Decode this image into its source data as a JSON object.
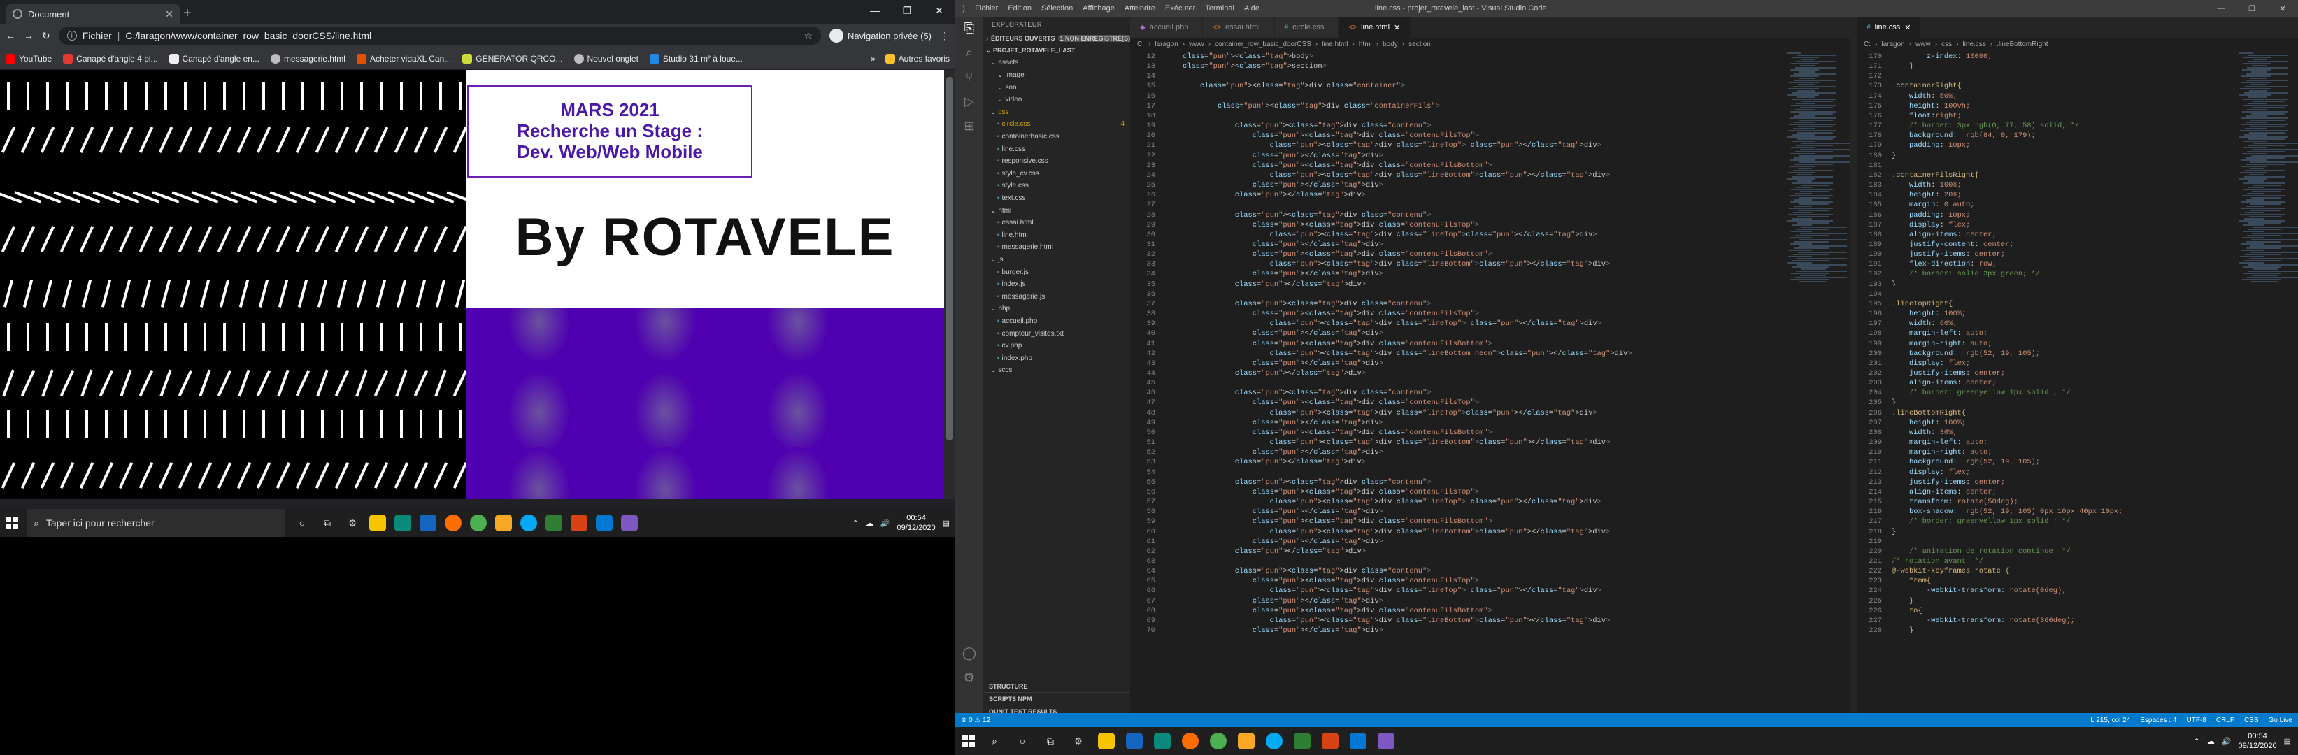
{
  "chrome": {
    "tab_title": "Document",
    "url_prefix": "Fichier",
    "url": "C:/laragon/www/container_row_basic_doorCSS/line.html",
    "private_label": "Navigation privée (5)",
    "bookmarks": [
      "YouTube",
      "Canapé d'angle 4 pl...",
      "Canapé d'angle en...",
      "messagerie.html",
      "Acheter vidaXL Can...",
      "GENERATOR QRCO...",
      "Nouvel onglet",
      "Studio 31 m² à loue..."
    ],
    "bookmarks_more": "»",
    "bookmarks_other": "Autres favoris"
  },
  "page": {
    "line1": "MARS 2021",
    "line2": "Recherche un Stage :",
    "line3": "Dev. Web/Web Mobile",
    "byline": "By ROTAVELE"
  },
  "taskbar": {
    "search_placeholder": "Taper ici pour rechercher",
    "time": "00:54",
    "date": "09/12/2020"
  },
  "vscode": {
    "title": "line.css - projet_rotavele_last - Visual Studio Code",
    "menu": [
      "Fichier",
      "Edition",
      "Sélection",
      "Affichage",
      "Atteindre",
      "Exécuter",
      "Terminal",
      "Aide"
    ],
    "explorer_label": "EXPLORATEUR",
    "open_editors": "ÉDITEURS OUVERTS",
    "unsaved_badge": "1 NON ENREGISTRÉ(S)",
    "project": "PROJET_ROTAVELE_LAST",
    "tree": [
      {
        "name": "assets",
        "depth": 1,
        "folder": true
      },
      {
        "name": "image",
        "depth": 2,
        "folder": true
      },
      {
        "name": "son",
        "depth": 2,
        "folder": true
      },
      {
        "name": "video",
        "depth": 2,
        "folder": true
      },
      {
        "name": "css",
        "depth": 1,
        "folder": true,
        "color": "#cca700"
      },
      {
        "name": "circle.css",
        "depth": 2,
        "badge": "4",
        "color": "#cca700"
      },
      {
        "name": "containerbasic.css",
        "depth": 2
      },
      {
        "name": "line.css",
        "depth": 2
      },
      {
        "name": "responsive.css",
        "depth": 2
      },
      {
        "name": "style_cv.css",
        "depth": 2
      },
      {
        "name": "style.css",
        "depth": 2
      },
      {
        "name": "text.css",
        "depth": 2
      },
      {
        "name": "html",
        "depth": 1,
        "folder": true
      },
      {
        "name": "essai.html",
        "depth": 2
      },
      {
        "name": "line.html",
        "depth": 2
      },
      {
        "name": "messagerie.html",
        "depth": 2
      },
      {
        "name": "js",
        "depth": 1,
        "folder": true
      },
      {
        "name": "burger.js",
        "depth": 2
      },
      {
        "name": "index.js",
        "depth": 2
      },
      {
        "name": "messagerie.js",
        "depth": 2
      },
      {
        "name": "php",
        "depth": 1,
        "folder": true
      },
      {
        "name": "accueil.php",
        "depth": 2
      },
      {
        "name": "compteur_visites.txt",
        "depth": 2
      },
      {
        "name": "cv.php",
        "depth": 2
      },
      {
        "name": "index.php",
        "depth": 2
      },
      {
        "name": "sccs",
        "depth": 1,
        "folder": true
      }
    ],
    "footer_sections": [
      "STRUCTURE",
      "SCRIPTS NPM",
      "QUNIT TEST RESULTS"
    ],
    "tabs_left": [
      "accueil.php",
      "essai.html",
      "circle.css",
      "line.html"
    ],
    "tabs_right": [
      "line.css"
    ],
    "breadcrumb_left": [
      "C:",
      "laragon",
      "www",
      "container_row_basic_doorCSS",
      "line.html",
      "html",
      "body",
      "section"
    ],
    "breadcrumb_right": [
      "C:",
      "laragon",
      "www",
      "css",
      "line.css",
      ".lineBottomRight"
    ],
    "status_left": "⊗ 0 ⚠ 12",
    "status_right": [
      "L 215, col 24",
      "Espaces : 4",
      "UTF-8",
      "CRLF",
      "CSS",
      "Go Live"
    ]
  },
  "html_code": [
    [
      12,
      "    <body>"
    ],
    [
      13,
      "    <section>"
    ],
    [
      14,
      ""
    ],
    [
      15,
      "        <div class=\"container\">"
    ],
    [
      16,
      ""
    ],
    [
      17,
      "            <div class=\"containerFils\">"
    ],
    [
      18,
      ""
    ],
    [
      19,
      "                <div class=\"contenu\">"
    ],
    [
      20,
      "                    <div class=\"contenuFilsTop\">"
    ],
    [
      21,
      "                        <div class=\"lineTop\"> </div>"
    ],
    [
      22,
      "                    </div>"
    ],
    [
      23,
      "                    <div class=\"contenuFilsBottom\">"
    ],
    [
      24,
      "                        <div class=\"lineBottom\"></div>"
    ],
    [
      25,
      "                    </div>"
    ],
    [
      26,
      "                </div>"
    ],
    [
      27,
      ""
    ],
    [
      28,
      "                <div class=\"contenu\">"
    ],
    [
      29,
      "                    <div class=\"contenuFilsTop\">"
    ],
    [
      30,
      "                        <div class=\"lineTop\"></div>"
    ],
    [
      31,
      "                    </div>"
    ],
    [
      32,
      "                    <div class=\"contenuFilsBottom\">"
    ],
    [
      33,
      "                        <div class=\"lineBottom\"></div>"
    ],
    [
      34,
      "                    </div>"
    ],
    [
      35,
      "                </div>"
    ],
    [
      36,
      ""
    ],
    [
      37,
      "                <div class=\"contenu\">"
    ],
    [
      38,
      "                    <div class=\"contenuFilsTop\">"
    ],
    [
      39,
      "                        <div class=\"lineTop\"> </div>"
    ],
    [
      40,
      "                    </div>"
    ],
    [
      41,
      "                    <div class=\"contenuFilsBottom\">"
    ],
    [
      42,
      "                        <div class=\"lineBottom neon\"></div>"
    ],
    [
      43,
      "                    </div>"
    ],
    [
      44,
      "                </div>"
    ],
    [
      45,
      ""
    ],
    [
      46,
      "                <div class=\"contenu\">"
    ],
    [
      47,
      "                    <div class=\"contenuFilsTop\">"
    ],
    [
      48,
      "                        <div class=\"lineTop\"></div>"
    ],
    [
      49,
      "                    </div>"
    ],
    [
      50,
      "                    <div class=\"contenuFilsBottom\">"
    ],
    [
      51,
      "                        <div class=\"lineBottom\"></div>"
    ],
    [
      52,
      "                    </div>"
    ],
    [
      53,
      "                </div>"
    ],
    [
      54,
      ""
    ],
    [
      55,
      "                <div class=\"contenu\">"
    ],
    [
      56,
      "                    <div class=\"contenuFilsTop\">"
    ],
    [
      57,
      "                        <div class=\"lineTop\"> </div>"
    ],
    [
      58,
      "                    </div>"
    ],
    [
      59,
      "                    <div class=\"contenuFilsBottom\">"
    ],
    [
      60,
      "                        <div class=\"lineBottom\"></div>"
    ],
    [
      61,
      "                    </div>"
    ],
    [
      62,
      "                </div>"
    ],
    [
      63,
      ""
    ],
    [
      64,
      "                <div class=\"contenu\">"
    ],
    [
      65,
      "                    <div class=\"contenuFilsTop\">"
    ],
    [
      66,
      "                        <div class=\"lineTop\"> </div>"
    ],
    [
      67,
      "                    </div>"
    ],
    [
      68,
      "                    <div class=\"contenuFilsBottom\">"
    ],
    [
      69,
      "                        <div class=\"lineBottom\"></div>"
    ],
    [
      70,
      "                    </div>"
    ]
  ],
  "css_code": [
    [
      170,
      "        z-index: 10000;"
    ],
    [
      171,
      "    }"
    ],
    [
      172,
      ""
    ],
    [
      173,
      ".containerRight{"
    ],
    [
      174,
      "    width: 50%;"
    ],
    [
      175,
      "    height: 100vh;"
    ],
    [
      176,
      "    float:right;"
    ],
    [
      177,
      "    /* border: 3px rgb(0, 77, 58) solid; */"
    ],
    [
      178,
      "    background:  rgb(84, 0, 179);"
    ],
    [
      179,
      "    padding: 10px;"
    ],
    [
      180,
      "}"
    ],
    [
      181,
      ""
    ],
    [
      182,
      ".containerFilsRight{"
    ],
    [
      183,
      "    width: 100%;"
    ],
    [
      184,
      "    height: 20%;"
    ],
    [
      185,
      "    margin: 0 auto;"
    ],
    [
      186,
      "    padding: 10px;"
    ],
    [
      187,
      "    display: flex;"
    ],
    [
      188,
      "    align-items: center;"
    ],
    [
      189,
      "    justify-content: center;"
    ],
    [
      190,
      "    justify-items: center;"
    ],
    [
      191,
      "    flex-direction: row;"
    ],
    [
      192,
      "    /* border: solid 3px green; */"
    ],
    [
      193,
      "}"
    ],
    [
      194,
      ""
    ],
    [
      195,
      ".lineTopRight{"
    ],
    [
      196,
      "    height: 100%;"
    ],
    [
      197,
      "    width: 60%;"
    ],
    [
      198,
      "    margin-left: auto;"
    ],
    [
      199,
      "    margin-right: auto;"
    ],
    [
      200,
      "    background:  rgb(52, 19, 105);"
    ],
    [
      201,
      "    display: flex;"
    ],
    [
      202,
      "    justify-items: center;"
    ],
    [
      203,
      "    align-items: center;"
    ],
    [
      204,
      "    /* border: greenyellow 1px solid ; */"
    ],
    [
      205,
      "}"
    ],
    [
      206,
      ".lineBottomRight{"
    ],
    [
      207,
      "    height: 100%;"
    ],
    [
      208,
      "    width: 30%;"
    ],
    [
      209,
      "    margin-left: auto;"
    ],
    [
      210,
      "    margin-right: auto;"
    ],
    [
      211,
      "    background:  rgb(52, 19, 105);"
    ],
    [
      212,
      "    display: flex;"
    ],
    [
      213,
      "    justify-items: center;"
    ],
    [
      214,
      "    align-items: center;"
    ],
    [
      215,
      "    transform: rotate(50deg);"
    ],
    [
      216,
      "    box-shadow:  rgb(52, 19, 105) 0px 10px 40px 10px;"
    ],
    [
      217,
      "    /* border: greenyellow 1px solid ; */"
    ],
    [
      218,
      "}"
    ],
    [
      219,
      ""
    ],
    [
      220,
      "    /* animation de rotation continue  */"
    ],
    [
      221,
      "/* rotation avant  */"
    ],
    [
      222,
      "@-webkit-keyframes rotate {"
    ],
    [
      223,
      "    from{"
    ],
    [
      224,
      "        -webkit-transform: rotate(0deg);"
    ],
    [
      225,
      "    }"
    ],
    [
      226,
      "    to{"
    ],
    [
      227,
      "        -webkit-transform: rotate(360deg);"
    ],
    [
      228,
      "    }"
    ]
  ]
}
